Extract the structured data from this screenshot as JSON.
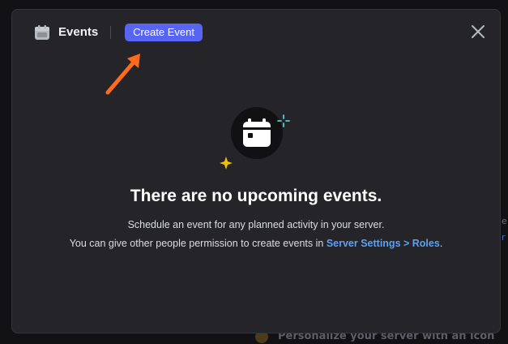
{
  "background": {
    "hint_text": "Personalize your server with an icon",
    "edge_char_1": "e",
    "edge_char_2": "r"
  },
  "modal": {
    "title": "Events",
    "create_button_label": "Create Event",
    "close_icon": "close-icon",
    "calendar_icon": "calendar-icon"
  },
  "empty_state": {
    "heading": "There are no upcoming events.",
    "line1": "Schedule an event for any planned activity in your server.",
    "line2_prefix": "You can give other people permission to create events in ",
    "line2_link": "Server Settings > Roles",
    "line2_suffix": "."
  },
  "colors": {
    "accent": "#5865f2",
    "link": "#5da1f5",
    "arrow": "#ff6b1a",
    "modal_bg": "#242429"
  }
}
